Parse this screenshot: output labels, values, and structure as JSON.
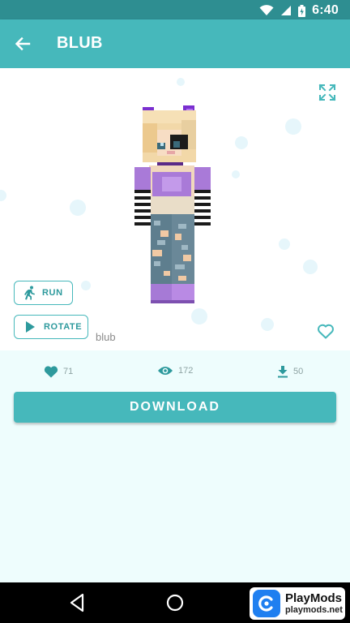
{
  "status_bar": {
    "time": "6:40"
  },
  "app_bar": {
    "title": "BLUB",
    "back_icon": "arrow-left-icon"
  },
  "preview": {
    "fullscreen_icon": "fullscreen-expand-icon",
    "run_label": "RUN",
    "rotate_label": "ROTATE",
    "skin_name": "blub",
    "favorite_icon": "heart-outline-icon"
  },
  "stats": {
    "likes": "71",
    "views": "172",
    "downloads": "50"
  },
  "actions": {
    "download_label": "DOWNLOAD"
  },
  "watermark": {
    "name": "PlayMods",
    "url": "playmods.net"
  },
  "colors": {
    "accent": "#46b8bb",
    "status_bar": "#2e8e91",
    "background": "#eefdfd",
    "stat_icon": "#2e9a9d"
  }
}
